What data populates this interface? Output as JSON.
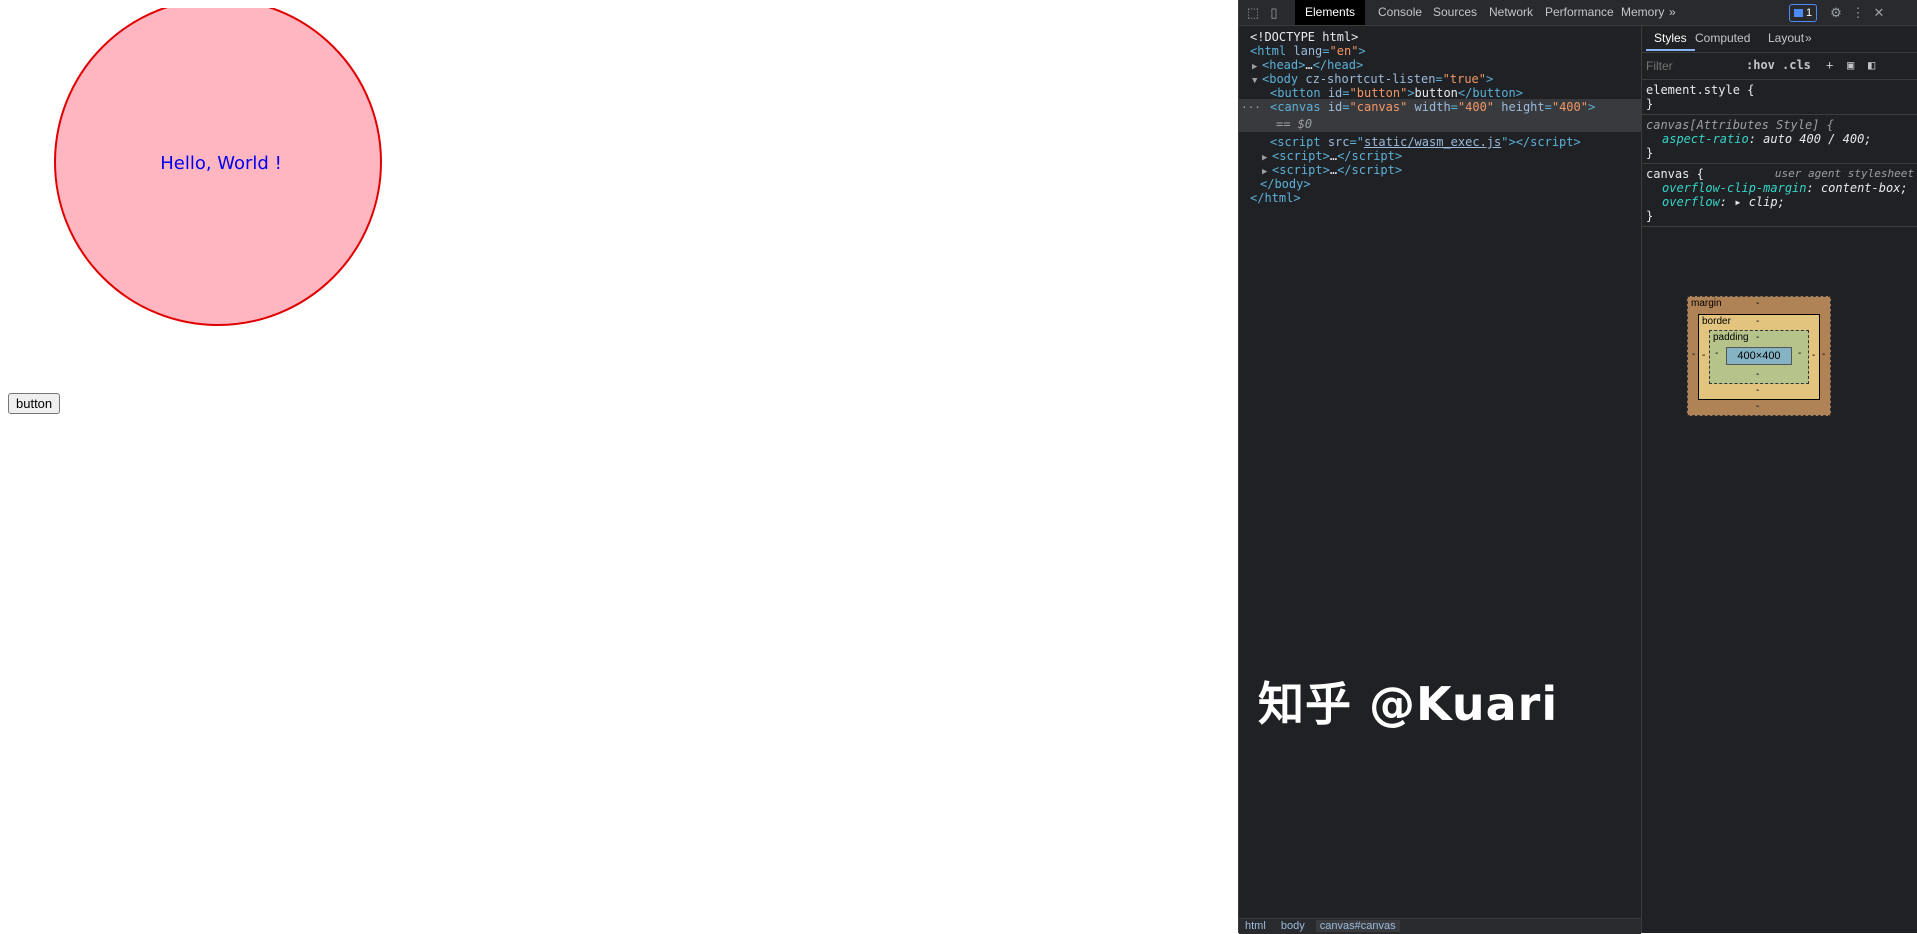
{
  "page": {
    "canvas_text": "Hello, World !",
    "button_label": "button",
    "colors": {
      "circle_fill": "#ffb6c1",
      "circle_stroke": "#e00000",
      "text": "#0000ee"
    }
  },
  "devtools": {
    "toolbar": {
      "tabs": [
        "Elements",
        "Console",
        "Sources",
        "Network",
        "Performance",
        "Memory"
      ],
      "more": "»",
      "issues_count": "1"
    },
    "tree": {
      "doctype": "<!DOCTYPE html>",
      "html_open_tag": "html",
      "html_attr": "lang",
      "html_attr_val": "\"en\"",
      "head": "head",
      "head_ellipsis": "…",
      "body_tag": "body",
      "body_attr": "cz-shortcut-listen",
      "body_attr_val": "\"true\"",
      "button_tag": "button",
      "button_id": "\"button\"",
      "button_text": "button",
      "canvas_tag": "canvas",
      "canvas_id": "\"canvas\"",
      "canvas_width": "\"400\"",
      "canvas_height": "\"400\"",
      "canvas_ref": "== $0",
      "script_src": "static/wasm_exec.js",
      "script_tag": "script",
      "ellipsis": "…",
      "body_close": "</body>",
      "html_close": "</html>"
    },
    "breadcrumb": [
      "html",
      "body",
      "canvas#canvas"
    ],
    "styles": {
      "tabs": [
        "Styles",
        "Computed",
        "Layout"
      ],
      "more": "»",
      "filter_placeholder": "Filter",
      "hov": ":hov",
      "cls": ".cls",
      "rules": [
        {
          "selector": "element.style {",
          "props": []
        },
        {
          "selector": "canvas[Attributes Style] {",
          "props": [
            {
              "name": "aspect-ratio",
              "value": "auto 400 / 400;"
            }
          ]
        },
        {
          "selector": "canvas {",
          "origin": "user agent stylesheet",
          "props": [
            {
              "name": "overflow-clip-margin",
              "value": "content-box;"
            },
            {
              "name": "overflow",
              "value": "clip;"
            }
          ]
        }
      ],
      "close_brace": "}",
      "boxmodel": {
        "margin_label": "margin",
        "border_label": "border",
        "padding_label": "padding",
        "content": "400×400",
        "dash": "-"
      }
    }
  },
  "watermark": "知乎 @Kuari"
}
